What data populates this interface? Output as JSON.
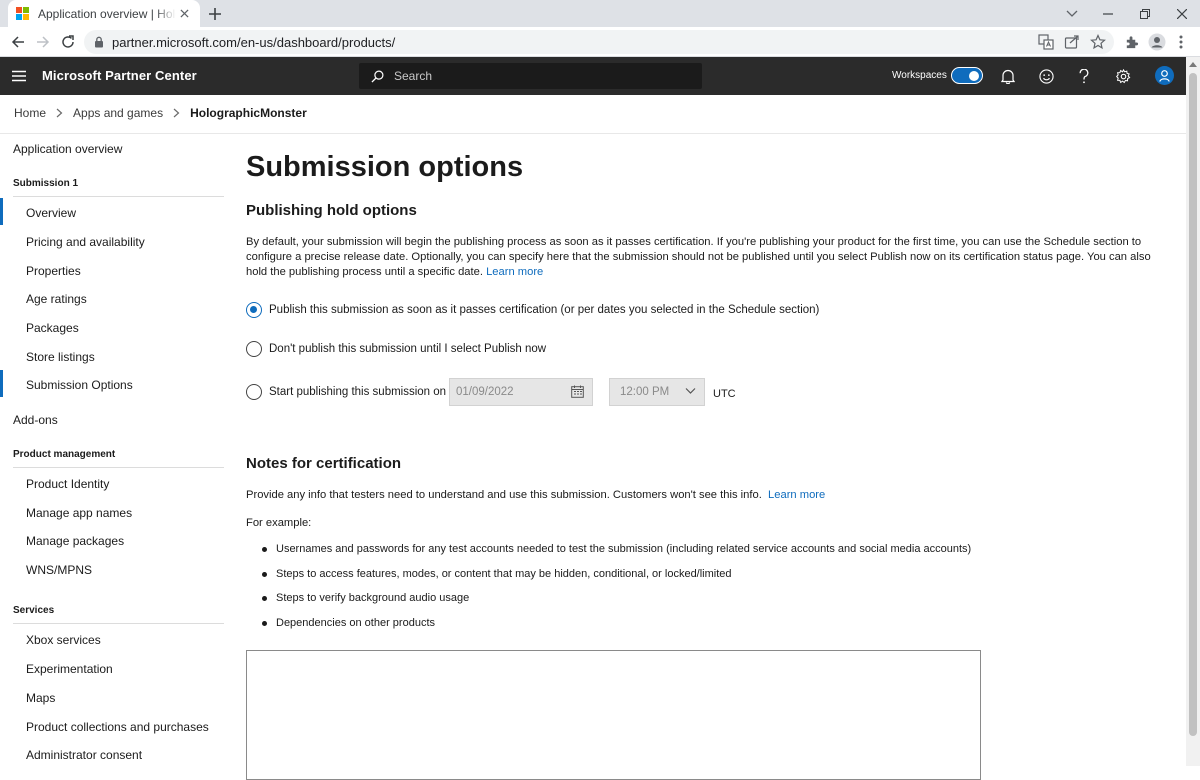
{
  "browser": {
    "tab_title": "Application overview | HolographicMonster",
    "url": "partner.microsoft.com/en-us/dashboard/products/"
  },
  "header": {
    "brand": "Microsoft Partner Center",
    "search_placeholder": "Search",
    "workspaces_label": "Workspaces",
    "workspaces_on": true,
    "accent_color": "#0f6cbd"
  },
  "breadcrumb": {
    "items": [
      "Home",
      "Apps and games",
      "HolographicMonster"
    ]
  },
  "leftnav": {
    "app_overview": "Application overview",
    "submission_heading": "Submission 1",
    "submission_items": [
      "Overview",
      "Pricing and availability",
      "Properties",
      "Age ratings",
      "Packages",
      "Store listings",
      "Submission Options"
    ],
    "addons": "Add-ons",
    "product_mgmt_heading": "Product management",
    "product_mgmt_items": [
      "Product Identity",
      "Manage app names",
      "Manage packages",
      "WNS/MPNS"
    ],
    "services_heading": "Services",
    "services_items": [
      "Xbox services",
      "Experimentation",
      "Maps",
      "Product collections and purchases",
      "Administrator consent"
    ]
  },
  "main": {
    "title": "Submission options",
    "hold_title": "Publishing hold options",
    "hold_description": "By default, your submission will begin the publishing process as soon as it passes certification. If you're publishing your product for the first time, you can use the Schedule section to configure a precise release date. Optionally, you can specify here that the submission should not be published until you select Publish now on its certification status page. You can also hold the publishing process until a specific date.",
    "hold_learn_more": "Learn more",
    "radio_options": [
      "Publish this submission as soon as it passes certification (or per dates you selected in the Schedule section)",
      "Don't publish this submission until I select Publish now",
      "Start publishing this submission on"
    ],
    "selected_option": 0,
    "date_value": "01/09/2022",
    "time_value": "12:00 PM",
    "timezone": "UTC",
    "notes_title": "Notes for certification",
    "notes_description": "Provide any info that testers need to understand and use this submission. Customers won't see this info.",
    "notes_learn_more": "Learn more",
    "for_example": "For example:",
    "examples": [
      "Usernames and passwords for any test accounts needed to test the submission (including related service accounts and social media accounts)",
      "Steps to access features, modes, or content that may be hidden, conditional, or locked/limited",
      "Steps to verify background audio usage",
      "Dependencies on other products"
    ],
    "notes_value": ""
  }
}
